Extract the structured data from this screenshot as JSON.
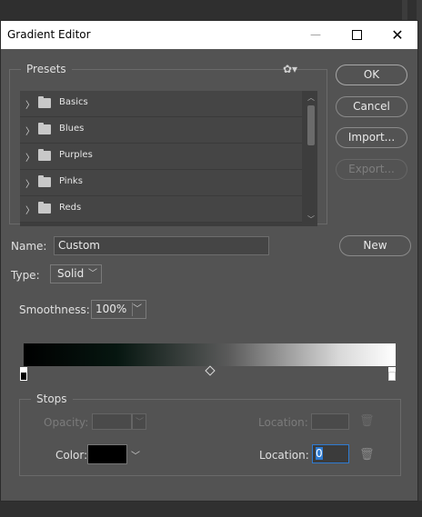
{
  "window": {
    "title": "Gradient Editor",
    "minimize_icon": "minimize-icon",
    "maximize_icon": "maximize-icon",
    "close_icon": "close-icon"
  },
  "presets": {
    "label": "Presets",
    "items": [
      {
        "label": "Basics"
      },
      {
        "label": "Blues"
      },
      {
        "label": "Purples"
      },
      {
        "label": "Pinks"
      },
      {
        "label": "Reds"
      }
    ]
  },
  "buttons": {
    "ok": "OK",
    "cancel": "Cancel",
    "import": "Import...",
    "export": "Export...",
    "new": "New"
  },
  "name": {
    "label": "Name:",
    "value": "Custom"
  },
  "type": {
    "label": "Type:",
    "value": "Solid"
  },
  "smoothness": {
    "label": "Smoothness:",
    "value": "100%"
  },
  "gradient": {
    "colors": [
      "#000000",
      "#061610",
      "#5a5a5a",
      "#d9d9d9",
      "#ffffff"
    ]
  },
  "stops": {
    "label": "Stops",
    "opacity_label": "Opacity:",
    "opacity_location_label": "Location:",
    "color_label": "Color:",
    "color_value": "#000000",
    "color_location_label": "Location:",
    "color_location_value": "0"
  },
  "colors": {
    "dialog_bg": "#535353",
    "focus_accent": "#2f7bd1"
  }
}
